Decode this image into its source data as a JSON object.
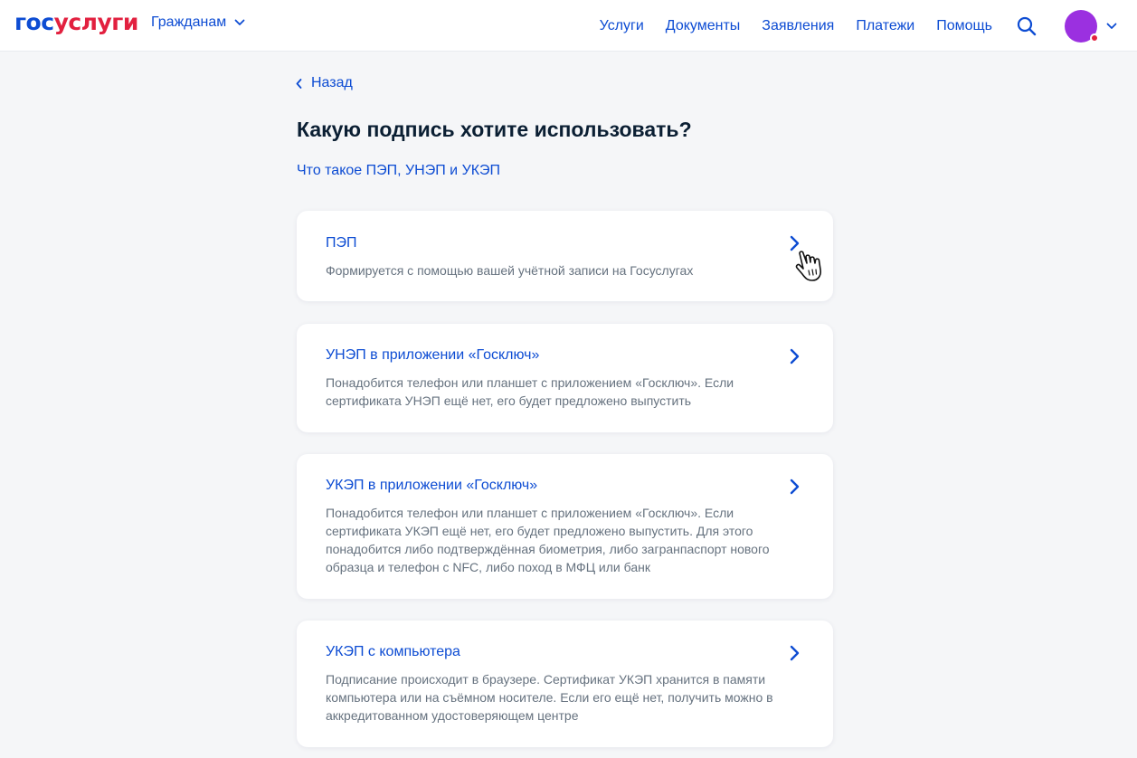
{
  "header": {
    "logo_part1": "гос",
    "logo_part2": "услуги",
    "audience_label": "Гражданам",
    "nav": [
      "Услуги",
      "Документы",
      "Заявления",
      "Платежи",
      "Помощь"
    ]
  },
  "page": {
    "back_label": "Назад",
    "title": "Какую подпись хотите использовать?",
    "info_link": "Что такое ПЭП, УНЭП и УКЭП"
  },
  "options": [
    {
      "title": "ПЭП",
      "description": "Формируется с помощью вашей учётной записи на Госуслугах"
    },
    {
      "title": "УНЭП в приложении «Госключ»",
      "description": "Понадобится телефон или планшет с приложением «Госключ». Если сертификата УНЭП ещё нет, его будет предложено выпустить"
    },
    {
      "title": "УКЭП в приложении «Госключ»",
      "description": "Понадобится телефон или планшет с приложением «Госключ». Если сертификата УКЭП ещё нет, его будет предложено выпустить. Для этого понадобится либо подтверждённая биометрия, либо загранпаспорт нового образца и телефон с NFC, либо поход в МФЦ или банк"
    },
    {
      "title": "УКЭП с компьютера",
      "description": "Подписание происходит в браузере. Сертификат УКЭП хранится в памяти компьютера или на съёмном носителе. Если его ещё нет, получить можно в аккредитованном удостоверяющем центре"
    }
  ],
  "colors": {
    "brand_blue": "#0d4cd3",
    "brand_red": "#e2203f",
    "avatar": "#9b30e0",
    "background": "#f5f6f8"
  },
  "icons": [
    "chevron-down-icon",
    "search-icon",
    "chevron-left-icon",
    "chevron-right-icon",
    "hand-cursor-icon"
  ]
}
